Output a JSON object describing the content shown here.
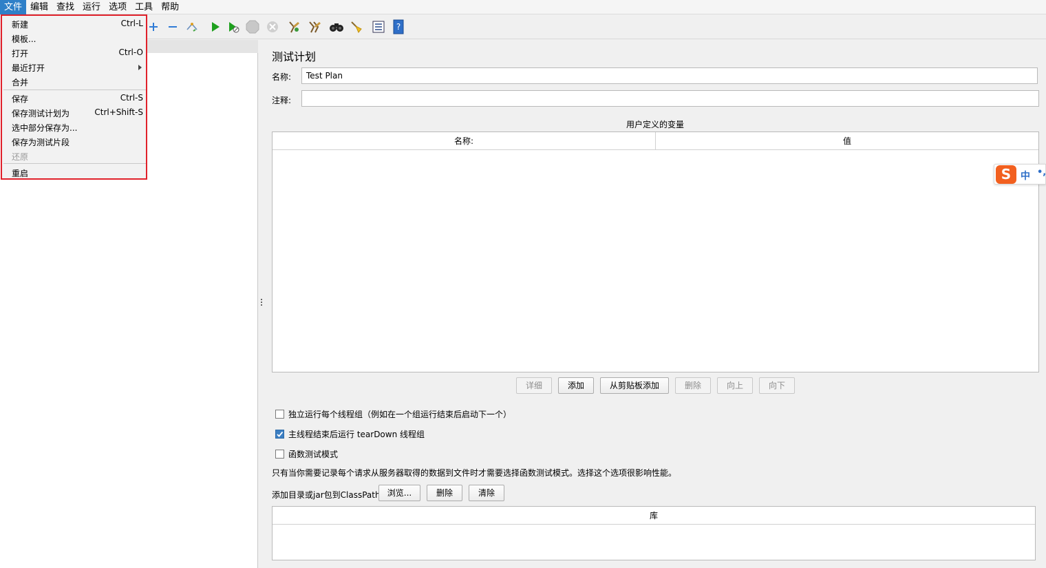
{
  "menubar": {
    "items": [
      "文件",
      "编辑",
      "查找",
      "运行",
      "选项",
      "工具",
      "帮助"
    ]
  },
  "toolbar": {
    "icons": [
      "add-icon",
      "remove-icon",
      "toggle-icon",
      "start-icon",
      "start-no-pause-icon",
      "stop-icon",
      "shutdown-icon",
      "clear-icon",
      "clear-all-icon",
      "search-binoculars-icon",
      "reset-search-broom-icon",
      "function-helper-icon",
      "help-icon"
    ]
  },
  "file_menu": {
    "items": [
      {
        "label": "新建",
        "shortcut": "Ctrl-L"
      },
      {
        "label": "模板...",
        "shortcut": ""
      },
      {
        "label": "打开",
        "shortcut": "Ctrl-O"
      },
      {
        "label": "最近打开",
        "shortcut": ""
      },
      {
        "label": "合并",
        "shortcut": ""
      },
      {
        "label": "保存",
        "shortcut": "Ctrl-S"
      },
      {
        "label": "保存测试计划为",
        "shortcut": "Ctrl+Shift-S"
      },
      {
        "label": "选中部分保存为...",
        "shortcut": ""
      },
      {
        "label": "保存为测试片段",
        "shortcut": ""
      },
      {
        "label": "还原",
        "shortcut": ""
      },
      {
        "label": "重启",
        "shortcut": ""
      }
    ]
  },
  "test_plan": {
    "title": "测试计划",
    "name_label": "名称:",
    "name_value": "Test Plan",
    "comment_label": "注释:",
    "comment_value": "",
    "udv_title": "用户定义的变量",
    "udv_columns": [
      "名称:",
      "值"
    ],
    "buttons": {
      "detail": "详细",
      "add": "添加",
      "add_clipboard": "从剪贴板添加",
      "delete": "删除",
      "up": "向上",
      "down": "向下"
    },
    "options": {
      "serial": "独立运行每个线程组（例如在一个组运行结束后启动下一个）",
      "teardown": "主线程结束后运行 tearDown 线程组",
      "functional": "函数测试模式"
    },
    "functional_note": "只有当你需要记录每个请求从服务器取得的数据到文件时才需要选择函数测试模式。选择这个选项很影响性能。",
    "classpath_label": "添加目录或jar包到ClassPath",
    "classpath_buttons": {
      "browse": "浏览...",
      "delete": "删除",
      "clear": "清除"
    },
    "library_column": "库"
  },
  "ime": {
    "logo": "S",
    "mode": "中",
    "punct": "•,"
  }
}
